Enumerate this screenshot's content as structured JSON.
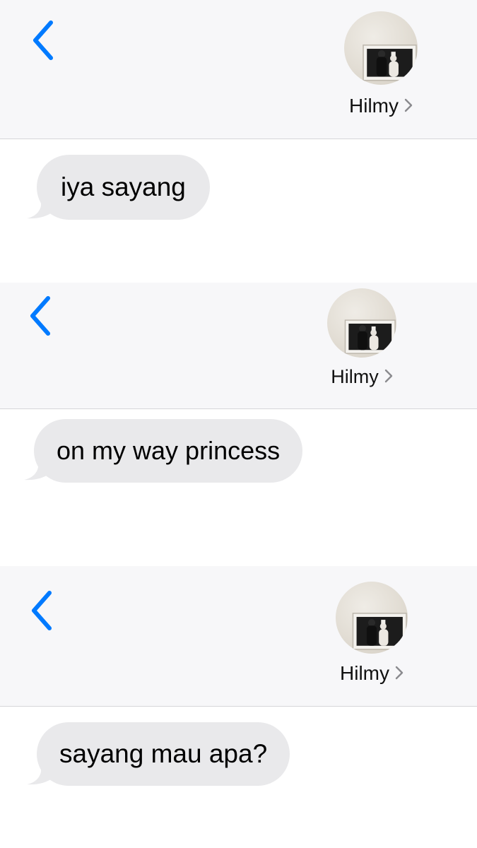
{
  "screens": [
    {
      "contact": {
        "name": "Hilmy",
        "avatar_icon": "contact-avatar-photo",
        "chevron_icon": "chevron-right-icon"
      },
      "back_icon": "chevron-left-icon",
      "message": {
        "text": "iya sayang",
        "direction": "incoming"
      }
    },
    {
      "contact": {
        "name": "Hilmy",
        "avatar_icon": "contact-avatar-photo",
        "chevron_icon": "chevron-right-icon"
      },
      "back_icon": "chevron-left-icon",
      "message": {
        "text": "on my way princess",
        "direction": "incoming"
      }
    },
    {
      "contact": {
        "name": "Hilmy",
        "avatar_icon": "contact-avatar-photo",
        "chevron_icon": "chevron-right-icon"
      },
      "back_icon": "chevron-left-icon",
      "message": {
        "text": "sayang mau apa?",
        "direction": "incoming"
      }
    }
  ],
  "colors": {
    "accent": "#007aff",
    "header_bg": "#f7f7f9",
    "incoming_bubble": "#e9e9eb",
    "divider": "#d6d6d9"
  }
}
